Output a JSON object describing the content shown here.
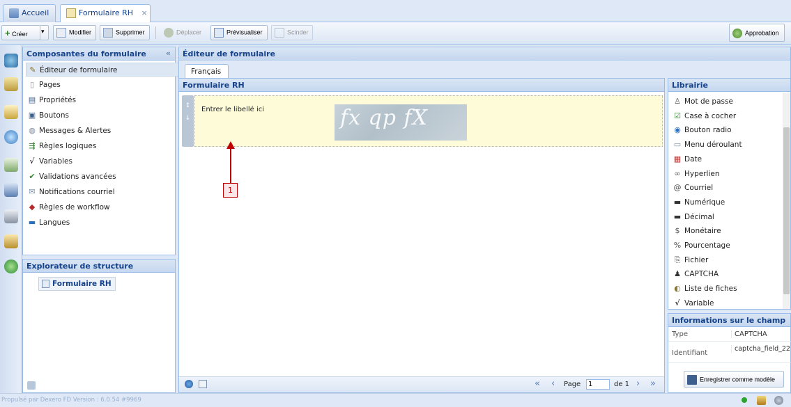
{
  "tabs": [
    {
      "label": "Accueil"
    },
    {
      "label": "Formulaire RH",
      "close": "×"
    }
  ],
  "toolbar": {
    "create": "Créer",
    "create_dropdown": "▾",
    "modify": "Modifier",
    "delete": "Supprimer",
    "move": "Déplacer",
    "preview": "Prévisualiser",
    "split": "Scinder",
    "approval": "Approbation"
  },
  "components_panel": {
    "title": "Composantes du formulaire",
    "collapse": "«",
    "items": [
      {
        "label": "Éditeur de formulaire",
        "icon": "form-editor-icon"
      },
      {
        "label": "Pages",
        "icon": "page-icon"
      },
      {
        "label": "Propriétés",
        "icon": "properties-icon"
      },
      {
        "label": "Boutons",
        "icon": "buttons-icon"
      },
      {
        "label": "Messages & Alertes",
        "icon": "messages-icon"
      },
      {
        "label": "Règles logiques",
        "icon": "logic-rules-icon"
      },
      {
        "label": "Variables",
        "icon": "variables-icon"
      },
      {
        "label": "Validations avancées",
        "icon": "validations-icon"
      },
      {
        "label": "Notifications courriel",
        "icon": "email-notification-icon"
      },
      {
        "label": "Règles de workflow",
        "icon": "workflow-icon"
      },
      {
        "label": "Langues",
        "icon": "languages-icon"
      }
    ]
  },
  "structure_panel": {
    "title": "Explorateur de structure",
    "node": "Formulaire RH"
  },
  "editor": {
    "title": "Éditeur de formulaire",
    "language_tab": "Français",
    "form_title": "Formulaire RH",
    "field_label_placeholder": "Entrer le libellé ici",
    "captcha_text": "fx qp fX",
    "callout_number": "1"
  },
  "pagination": {
    "page_label": "Page",
    "page_value": "1",
    "of_label": "de 1"
  },
  "library": {
    "title": "Librairie",
    "items": [
      {
        "label": "Mot de passe",
        "icon": "password-icon"
      },
      {
        "label": "Case à cocher",
        "icon": "checkbox-icon"
      },
      {
        "label": "Bouton radio",
        "icon": "radio-icon"
      },
      {
        "label": "Menu déroulant",
        "icon": "dropdown-icon"
      },
      {
        "label": "Date",
        "icon": "date-icon"
      },
      {
        "label": "Hyperlien",
        "icon": "hyperlink-icon"
      },
      {
        "label": "Courriel",
        "icon": "email-icon"
      },
      {
        "label": "Numérique",
        "icon": "numeric-icon"
      },
      {
        "label": "Décimal",
        "icon": "decimal-icon"
      },
      {
        "label": "Monétaire",
        "icon": "currency-icon"
      },
      {
        "label": "Pourcentage",
        "icon": "percent-icon"
      },
      {
        "label": "Fichier",
        "icon": "file-icon"
      },
      {
        "label": "CAPTCHA",
        "icon": "captcha-icon"
      },
      {
        "label": "Liste de fiches",
        "icon": "record-list-icon"
      },
      {
        "label": "Variable",
        "icon": "variable-icon"
      }
    ]
  },
  "field_info": {
    "title": "Informations sur le champ",
    "rows": [
      {
        "key": "Type",
        "value": "CAPTCHA"
      },
      {
        "key": "Identifiant",
        "value": "captcha_field_22"
      }
    ],
    "save_template": "Enregistrer comme modèle"
  },
  "status": {
    "version": "Propulsé par Dexero FD Version : 6.0.54 #9969"
  },
  "colors": {
    "accent": "#15428b",
    "border": "#99bbe8",
    "field_bg": "#fdfbd8",
    "callout": "#c00000"
  }
}
